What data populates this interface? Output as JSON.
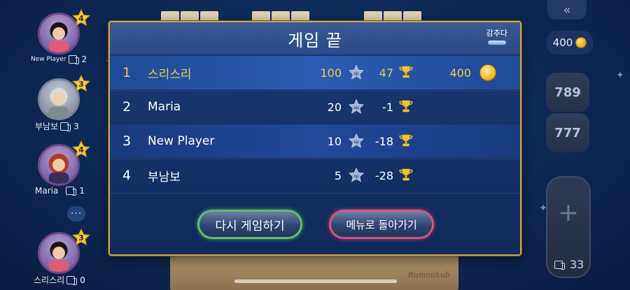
{
  "players": [
    {
      "name": "New Player",
      "cards": "2",
      "level": "4"
    },
    {
      "name": "부남보",
      "cards": "3",
      "level": "3"
    },
    {
      "name": "Maria",
      "cards": "1",
      "level": "4"
    },
    {
      "name": "스리스리",
      "cards": "0",
      "level": "3"
    }
  ],
  "chat": {
    "label": "···"
  },
  "top_right": {
    "collapse": "«",
    "coins": "400"
  },
  "tile_stacks": [
    "789",
    "777"
  ],
  "draw_pile": {
    "plus": "+",
    "count": "33"
  },
  "board": {
    "logo": "Rummikub"
  },
  "modal": {
    "title": "게임 끝",
    "hide_label": "감추다",
    "rows": [
      {
        "rank": "1",
        "name": "스리스리",
        "xp": "100",
        "trophies": "47",
        "coins": "400"
      },
      {
        "rank": "2",
        "name": "Maria",
        "xp": "20",
        "trophies": "-1"
      },
      {
        "rank": "3",
        "name": "New Player",
        "xp": "10",
        "trophies": "-18"
      },
      {
        "rank": "4",
        "name": "부남보",
        "xp": "5",
        "trophies": "-28"
      }
    ],
    "xp_badge": "xp",
    "play_again": "다시 게임하기",
    "back_to_menu": "메뉴로 돌아가기"
  },
  "colors": {
    "accent_gold": "#f2c94c",
    "play_border": "#5fbf6a",
    "menu_border": "#d2577a"
  }
}
